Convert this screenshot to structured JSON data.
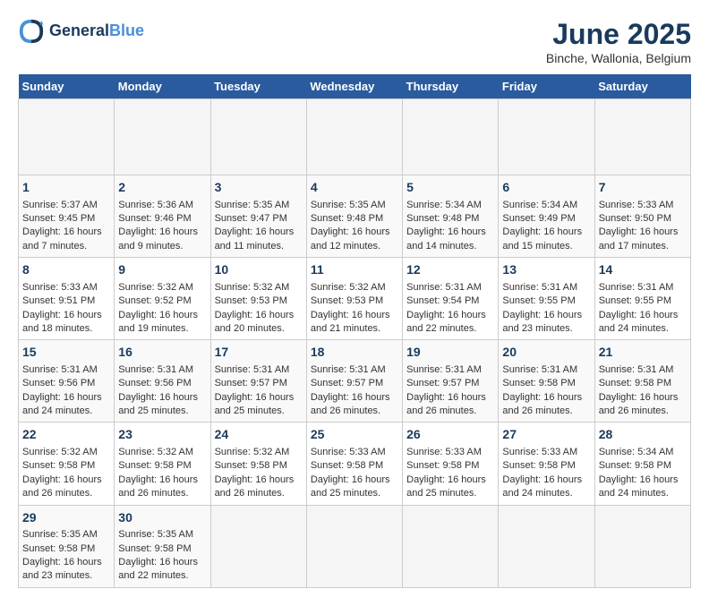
{
  "header": {
    "logo_general": "General",
    "logo_blue": "Blue",
    "month_title": "June 2025",
    "location": "Binche, Wallonia, Belgium"
  },
  "calendar": {
    "days_of_week": [
      "Sunday",
      "Monday",
      "Tuesday",
      "Wednesday",
      "Thursday",
      "Friday",
      "Saturday"
    ],
    "weeks": [
      {
        "cells": [
          {
            "day": "",
            "empty": true
          },
          {
            "day": "",
            "empty": true
          },
          {
            "day": "",
            "empty": true
          },
          {
            "day": "",
            "empty": true
          },
          {
            "day": "",
            "empty": true
          },
          {
            "day": "",
            "empty": true
          },
          {
            "day": "",
            "empty": true
          }
        ]
      },
      {
        "cells": [
          {
            "day": "1",
            "sunrise": "Sunrise: 5:37 AM",
            "sunset": "Sunset: 9:45 PM",
            "daylight": "Daylight: 16 hours and 7 minutes."
          },
          {
            "day": "2",
            "sunrise": "Sunrise: 5:36 AM",
            "sunset": "Sunset: 9:46 PM",
            "daylight": "Daylight: 16 hours and 9 minutes."
          },
          {
            "day": "3",
            "sunrise": "Sunrise: 5:35 AM",
            "sunset": "Sunset: 9:47 PM",
            "daylight": "Daylight: 16 hours and 11 minutes."
          },
          {
            "day": "4",
            "sunrise": "Sunrise: 5:35 AM",
            "sunset": "Sunset: 9:48 PM",
            "daylight": "Daylight: 16 hours and 12 minutes."
          },
          {
            "day": "5",
            "sunrise": "Sunrise: 5:34 AM",
            "sunset": "Sunset: 9:48 PM",
            "daylight": "Daylight: 16 hours and 14 minutes."
          },
          {
            "day": "6",
            "sunrise": "Sunrise: 5:34 AM",
            "sunset": "Sunset: 9:49 PM",
            "daylight": "Daylight: 16 hours and 15 minutes."
          },
          {
            "day": "7",
            "sunrise": "Sunrise: 5:33 AM",
            "sunset": "Sunset: 9:50 PM",
            "daylight": "Daylight: 16 hours and 17 minutes."
          }
        ]
      },
      {
        "cells": [
          {
            "day": "8",
            "sunrise": "Sunrise: 5:33 AM",
            "sunset": "Sunset: 9:51 PM",
            "daylight": "Daylight: 16 hours and 18 minutes."
          },
          {
            "day": "9",
            "sunrise": "Sunrise: 5:32 AM",
            "sunset": "Sunset: 9:52 PM",
            "daylight": "Daylight: 16 hours and 19 minutes."
          },
          {
            "day": "10",
            "sunrise": "Sunrise: 5:32 AM",
            "sunset": "Sunset: 9:53 PM",
            "daylight": "Daylight: 16 hours and 20 minutes."
          },
          {
            "day": "11",
            "sunrise": "Sunrise: 5:32 AM",
            "sunset": "Sunset: 9:53 PM",
            "daylight": "Daylight: 16 hours and 21 minutes."
          },
          {
            "day": "12",
            "sunrise": "Sunrise: 5:31 AM",
            "sunset": "Sunset: 9:54 PM",
            "daylight": "Daylight: 16 hours and 22 minutes."
          },
          {
            "day": "13",
            "sunrise": "Sunrise: 5:31 AM",
            "sunset": "Sunset: 9:55 PM",
            "daylight": "Daylight: 16 hours and 23 minutes."
          },
          {
            "day": "14",
            "sunrise": "Sunrise: 5:31 AM",
            "sunset": "Sunset: 9:55 PM",
            "daylight": "Daylight: 16 hours and 24 minutes."
          }
        ]
      },
      {
        "cells": [
          {
            "day": "15",
            "sunrise": "Sunrise: 5:31 AM",
            "sunset": "Sunset: 9:56 PM",
            "daylight": "Daylight: 16 hours and 24 minutes."
          },
          {
            "day": "16",
            "sunrise": "Sunrise: 5:31 AM",
            "sunset": "Sunset: 9:56 PM",
            "daylight": "Daylight: 16 hours and 25 minutes."
          },
          {
            "day": "17",
            "sunrise": "Sunrise: 5:31 AM",
            "sunset": "Sunset: 9:57 PM",
            "daylight": "Daylight: 16 hours and 25 minutes."
          },
          {
            "day": "18",
            "sunrise": "Sunrise: 5:31 AM",
            "sunset": "Sunset: 9:57 PM",
            "daylight": "Daylight: 16 hours and 26 minutes."
          },
          {
            "day": "19",
            "sunrise": "Sunrise: 5:31 AM",
            "sunset": "Sunset: 9:57 PM",
            "daylight": "Daylight: 16 hours and 26 minutes."
          },
          {
            "day": "20",
            "sunrise": "Sunrise: 5:31 AM",
            "sunset": "Sunset: 9:58 PM",
            "daylight": "Daylight: 16 hours and 26 minutes."
          },
          {
            "day": "21",
            "sunrise": "Sunrise: 5:31 AM",
            "sunset": "Sunset: 9:58 PM",
            "daylight": "Daylight: 16 hours and 26 minutes."
          }
        ]
      },
      {
        "cells": [
          {
            "day": "22",
            "sunrise": "Sunrise: 5:32 AM",
            "sunset": "Sunset: 9:58 PM",
            "daylight": "Daylight: 16 hours and 26 minutes."
          },
          {
            "day": "23",
            "sunrise": "Sunrise: 5:32 AM",
            "sunset": "Sunset: 9:58 PM",
            "daylight": "Daylight: 16 hours and 26 minutes."
          },
          {
            "day": "24",
            "sunrise": "Sunrise: 5:32 AM",
            "sunset": "Sunset: 9:58 PM",
            "daylight": "Daylight: 16 hours and 26 minutes."
          },
          {
            "day": "25",
            "sunrise": "Sunrise: 5:33 AM",
            "sunset": "Sunset: 9:58 PM",
            "daylight": "Daylight: 16 hours and 25 minutes."
          },
          {
            "day": "26",
            "sunrise": "Sunrise: 5:33 AM",
            "sunset": "Sunset: 9:58 PM",
            "daylight": "Daylight: 16 hours and 25 minutes."
          },
          {
            "day": "27",
            "sunrise": "Sunrise: 5:33 AM",
            "sunset": "Sunset: 9:58 PM",
            "daylight": "Daylight: 16 hours and 24 minutes."
          },
          {
            "day": "28",
            "sunrise": "Sunrise: 5:34 AM",
            "sunset": "Sunset: 9:58 PM",
            "daylight": "Daylight: 16 hours and 24 minutes."
          }
        ]
      },
      {
        "cells": [
          {
            "day": "29",
            "sunrise": "Sunrise: 5:35 AM",
            "sunset": "Sunset: 9:58 PM",
            "daylight": "Daylight: 16 hours and 23 minutes."
          },
          {
            "day": "30",
            "sunrise": "Sunrise: 5:35 AM",
            "sunset": "Sunset: 9:58 PM",
            "daylight": "Daylight: 16 hours and 22 minutes."
          },
          {
            "day": "",
            "empty": true
          },
          {
            "day": "",
            "empty": true
          },
          {
            "day": "",
            "empty": true
          },
          {
            "day": "",
            "empty": true
          },
          {
            "day": "",
            "empty": true
          }
        ]
      }
    ]
  }
}
